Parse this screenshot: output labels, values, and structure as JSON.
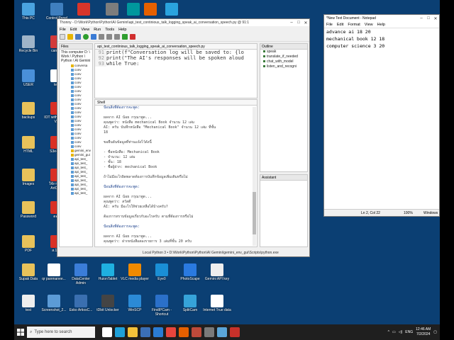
{
  "desktop": {
    "icons": [
      {
        "label": "This PC",
        "icon": "computer-icon",
        "color": "#4aa3e0"
      },
      {
        "label": "Control Panel",
        "icon": "control-panel-icon",
        "color": "#3f7fbf"
      },
      {
        "label": "Recycle Bin",
        "icon": "recycle-bin-icon",
        "color": "#9fb4c8"
      },
      {
        "label": "canvas",
        "icon": "app-icon",
        "color": "#d23b3b"
      },
      {
        "label": "USER",
        "icon": "user-folder-icon",
        "color": "#4a90d9"
      },
      {
        "label": "text",
        "icon": "file-icon",
        "color": "#ffffff"
      },
      {
        "label": "backups",
        "icon": "folder-icon",
        "color": "#e8c25a"
      },
      {
        "label": "IOT with ESP32 V...",
        "icon": "pdf-icon",
        "color": "#d93025"
      },
      {
        "label": "HTML",
        "icon": "folder-icon",
        "color": "#e8c25a"
      },
      {
        "label": "S3e-spin",
        "icon": "pdf-icon",
        "color": "#d93025"
      },
      {
        "label": "Images",
        "icon": "folder-icon",
        "color": "#e8c25a"
      },
      {
        "label": "ใช้การเริ่ม ArtCAM",
        "icon": "pdf-icon",
        "color": "#d93025"
      },
      {
        "label": "Password",
        "icon": "folder-icon",
        "color": "#e8c25a"
      },
      {
        "label": "ตอบ",
        "icon": "pdf-icon",
        "color": "#d93025"
      },
      {
        "label": "PDF",
        "icon": "folder-icon",
        "color": "#e8c25a"
      },
      {
        "label": "ส.1.11",
        "icon": "pdf-icon",
        "color": "#d93025"
      },
      {
        "label": "Supak Data",
        "icon": "folder-icon",
        "color": "#e8c25a"
      },
      {
        "label": "qr panmanee...",
        "icon": "qr-icon",
        "color": "#ffffff"
      },
      {
        "label": "DataCenter Admin",
        "icon": "app-icon",
        "color": "#3b7dd8"
      },
      {
        "label": "HuionTablet",
        "icon": "app-icon",
        "color": "#1fb0e0"
      },
      {
        "label": "VLC media player",
        "icon": "vlc-icon",
        "color": "#f08a00"
      },
      {
        "label": "Eye0",
        "icon": "app-icon",
        "color": "#1a8fd6"
      },
      {
        "label": "PhotoScape",
        "icon": "app-icon",
        "color": "#2a7ae0"
      },
      {
        "label": "Gemini API key",
        "icon": "file-icon",
        "color": "#eeeeee"
      },
      {
        "label": "test",
        "icon": "file-icon",
        "color": "#eeeeee"
      },
      {
        "label": "Screenshot_2...",
        "icon": "image-icon",
        "color": "#5c9bd6"
      },
      {
        "label": "Esko ArtiosC...",
        "icon": "app-icon",
        "color": "#3a6fb0"
      },
      {
        "label": "tDbit Unlocker",
        "icon": "app-icon",
        "color": "#444444"
      },
      {
        "label": "WinSCP",
        "icon": "app-icon",
        "color": "#2b8ad6"
      },
      {
        "label": "FindIPCam - Shortcut",
        "icon": "app-icon",
        "color": "#2b70c9"
      },
      {
        "label": "SplitCam",
        "icon": "app-icon",
        "color": "#36a3d9"
      },
      {
        "label": "Internet True data",
        "icon": "file-icon",
        "color": "#ffffff"
      }
    ],
    "top_icons": [
      {
        "icon": "anydesk-icon",
        "color": "#d8352a"
      },
      {
        "icon": "app-icon",
        "color": "#7d7d7d"
      },
      {
        "icon": "arduino-icon",
        "color": "#00979d"
      },
      {
        "icon": "firefox-icon",
        "color": "#e66000"
      },
      {
        "icon": "telegram-icon",
        "color": "#2aa3de"
      }
    ]
  },
  "thonny": {
    "title": "Thonny - D:\\Work\\Python\\Python\\AI Gemini\\api_test_continious_talk_logging_speak_ai_conversation_speech.py @ 91:1",
    "menu": [
      "File",
      "Edit",
      "View",
      "Run",
      "Tools",
      "Help"
    ],
    "files_header": "Files",
    "files_path": "This computer D: \\ Work \\ Python \\ Python \\ AI Gemini",
    "files": [
      {
        "name": "conversa",
        "yellow": true
      },
      {
        "name": "conv",
        "yellow": false
      },
      {
        "name": "conv",
        "yellow": false
      },
      {
        "name": "conv",
        "yellow": false
      },
      {
        "name": "conv",
        "yellow": false
      },
      {
        "name": "conv",
        "yellow": false
      },
      {
        "name": "conv",
        "yellow": false
      },
      {
        "name": "conv",
        "yellow": false
      },
      {
        "name": "conv",
        "yellow": false
      },
      {
        "name": "conv",
        "yellow": false
      },
      {
        "name": "conv",
        "yellow": false
      },
      {
        "name": "conv",
        "yellow": false
      },
      {
        "name": "conv",
        "yellow": false
      },
      {
        "name": "conv",
        "yellow": false
      },
      {
        "name": "conv",
        "yellow": false
      },
      {
        "name": "conv",
        "yellow": false
      },
      {
        "name": "conv",
        "yellow": false
      },
      {
        "name": "conv",
        "yellow": false
      },
      {
        "name": "conv",
        "yellow": false
      },
      {
        "name": "conv",
        "yellow": false
      },
      {
        "name": "gemini_env",
        "yellow": true
      },
      {
        "name": "gemini_gui",
        "yellow": true
      },
      {
        "name": "api_test_",
        "yellow": false
      },
      {
        "name": "api_test_",
        "yellow": false
      },
      {
        "name": "api_test_",
        "yellow": false
      },
      {
        "name": "api_test_",
        "yellow": false
      },
      {
        "name": "api_test_",
        "yellow": false
      },
      {
        "name": "api_test_",
        "yellow": false
      },
      {
        "name": "api_test_",
        "yellow": false
      },
      {
        "name": "api_test_",
        "yellow": false
      },
      {
        "name": "api_test_",
        "yellow": false
      }
    ],
    "editor_tab": "api_test_continious_talk_logging_speak_ai_conversation_speech.py",
    "code": [
      {
        "ln": "91",
        "text": "print(f\"Conversation log will be saved to: {lo"
      },
      {
        "ln": "92",
        "text": "print(\"The AI's responses will be spoken aloud"
      },
      {
        "ln": "93",
        "text": "while True:"
      }
    ],
    "shell_tab": "Shell",
    "shell": [
      {
        "text": "ป้อนสิ่งที่ต้องการจะพูด: ",
        "blue": true
      },
      {
        "text": "",
        "blue": false
      },
      {
        "text": "ผลจาก AI น้อย กรุณาพูด...",
        "blue": false
      },
      {
        "text": "คุณพูดว่า: หนังสือ mechanical Book จำนวน 12 เล่ม",
        "blue": false
      },
      {
        "text": "AI: ครับ บันทึกหนังสือ \"Mechanical Book\" จำนวน 12 เล่ม ที่ชั้น",
        "blue": false
      },
      {
        "text": "18",
        "blue": false
      },
      {
        "text": "",
        "blue": false
      },
      {
        "text": "ขอยืนยันข้อมูลที่ท่านแจ้งไว้ดังนี้",
        "blue": false
      },
      {
        "text": "",
        "blue": false
      },
      {
        "text": "- ชื่อหนังสือ: Mechanical Book",
        "blue": false
      },
      {
        "text": "- จำนวน: 12 เล่ม",
        "blue": false
      },
      {
        "text": "- ชั้น: 18",
        "blue": false
      },
      {
        "text": "- ชื่อผู้ฝาก: mechanical Book",
        "blue": false
      },
      {
        "text": "",
        "blue": false
      },
      {
        "text": "ถ้าไม่มีอะไรผิดพลาดต้องการบันทึกข้อมูลเพิ่มเติมหรือไม่",
        "blue": false
      },
      {
        "text": "",
        "blue": false
      },
      {
        "text": "ป้อนสิ่งที่ต้องการจะพูด: ",
        "blue": true
      },
      {
        "text": "",
        "blue": false
      },
      {
        "text": "ผลจาก AI น้อย กรุณาพูด...",
        "blue": false
      },
      {
        "text": "คุณพูดว่า: สวัสดี",
        "blue": false
      },
      {
        "text": "AI: ครับ มีอะไรให้ช่วยเหลือได้บ้างครับ?",
        "blue": false
      },
      {
        "text": "",
        "blue": false
      },
      {
        "text": "ต้องการทราบข้อมูลเกี่ยวกับอะไรครับ ตามที่ต้องการหรือไม่",
        "blue": false
      },
      {
        "text": "",
        "blue": false
      },
      {
        "text": "ป้อนสิ่งที่ต้องการจะพูด: ",
        "blue": true
      },
      {
        "text": "",
        "blue": false
      },
      {
        "text": "ผลจาก AI น้อย กรุณาพูด...",
        "blue": false
      },
      {
        "text": "คุณพูดว่า: ฝากหนังสือสองรายการ 3 เล่มที่ชั้น 20 ครับ",
        "blue": false
      }
    ],
    "outline_header": "Outline",
    "outline": [
      "speak",
      "translate_if_needed",
      "chat_with_model",
      "listen_and_recogni"
    ],
    "assistant_header": "Assistant",
    "status": "Local Python 3  •  D:\\Work\\Python\\Python\\AI Gemini\\gemini_env_gui\\Scripts\\python.exe"
  },
  "notepad": {
    "title": "*New Text Document - Notepad",
    "menu": [
      "File",
      "Edit",
      "Format",
      "View",
      "Help"
    ],
    "lines": [
      "advance ai  18 20",
      "mechanical book 12 18",
      "computer science 3  20"
    ],
    "status_pos": "Ln 2, Col 22",
    "status_zoom": "100%",
    "status_eol": "Windows"
  },
  "taskbar": {
    "search_placeholder": "Type here to search",
    "apps": [
      {
        "icon": "task-view-icon",
        "color": "#ffffff"
      },
      {
        "icon": "edge-icon",
        "color": "#1fa0d8"
      },
      {
        "icon": "file-explorer-icon",
        "color": "#f3c13a"
      },
      {
        "icon": "store-icon",
        "color": "#3b6fb6"
      },
      {
        "icon": "mail-icon",
        "color": "#2b7cd3"
      },
      {
        "icon": "chrome-icon",
        "color": "#e8453c"
      },
      {
        "icon": "firefox-icon",
        "color": "#e66000"
      },
      {
        "icon": "app-icon",
        "color": "#c04a3a"
      },
      {
        "icon": "thonny-icon",
        "color": "#7a7a7a"
      },
      {
        "icon": "notepad-icon",
        "color": "#5aa5d8"
      },
      {
        "icon": "app-icon",
        "color": "#c7312a"
      }
    ],
    "tray_lang": "ENG",
    "time": "12:46 AM",
    "date": "7/2/2024"
  }
}
